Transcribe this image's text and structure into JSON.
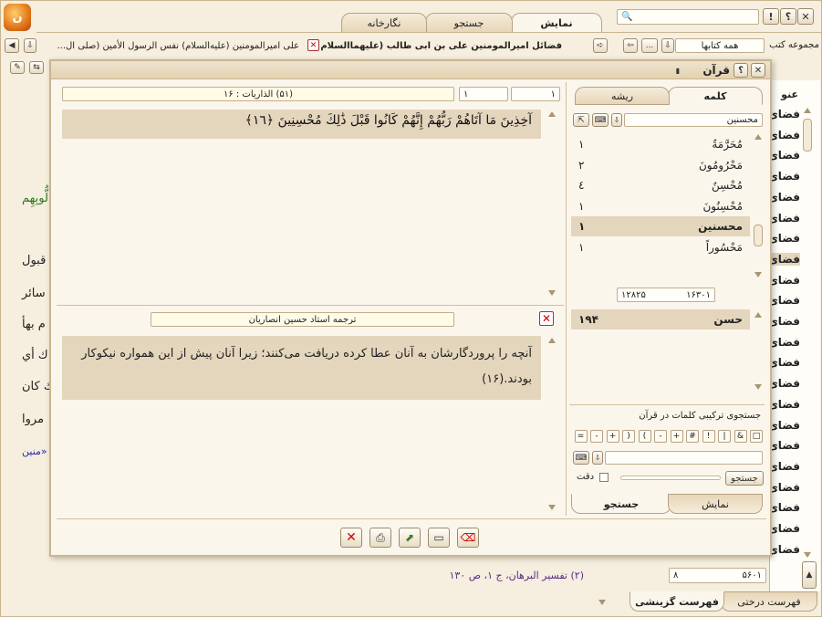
{
  "top_tabs": [
    {
      "label": "نمایش",
      "active": true
    },
    {
      "label": "جستجو",
      "active": false
    },
    {
      "label": "نگارخانه",
      "active": false
    }
  ],
  "top_right_buttons": {
    "close": "✕",
    "help": "؟",
    "alert": "!"
  },
  "search": {
    "placeholder": ""
  },
  "library": {
    "label": "مجموعه کتب",
    "selected": "همه کتابها"
  },
  "doc_tabs": [
    {
      "label": "فضائل امیرالمومنین علی بن ابی طالب (علیهماالسلام) فی..."
    },
    {
      "label": "علی امیرالمومنین (علیه‌السلام) نفس الرسول الأمین (صلی ال..."
    }
  ],
  "sidebar": {
    "header": "عنو",
    "item_label": "فضائ",
    "count": 22
  },
  "sidebar_footer": {
    "nav_left": "۵۶۰۱",
    "nav_right": "۸",
    "tabs": [
      {
        "label": "فهرست درختی"
      },
      {
        "label": "فهرست گزینشی"
      }
    ]
  },
  "background_text": {
    "words": [
      "لُّوبِهِم",
      "قبول",
      "سائر",
      "م بهأ",
      "ك أي",
      "ك كان",
      "مروا",
      "منين»"
    ],
    "footnote": "(۲) تفسیر البرهان، ج ۱، ص ۱۳۰"
  },
  "quran": {
    "title": "قرآن",
    "verse_nav": {
      "sura": "(۵۱) الذاريات : ۱۶",
      "field_a": "۱",
      "field_b": "۱"
    },
    "verse_text": "آخِذِينَ مَا آتَاهُمْ رَبُّهُمْ إِنَّهُمْ كَانُوا قَبْلَ ذَٰلِكَ مُحْسِنِينَ ﴿١٦﴾",
    "translation_title": "ترجمه استاد حسین انصاریان",
    "translation": "آنچه را پروردگارشان به آنان عطا کرده دریافت می‌کنند؛ زیرا آنان پیش از این همواره نیکوکار بودند.(۱۶)",
    "panel_tabs": [
      {
        "label": "کلمه",
        "active": true
      },
      {
        "label": "ریشه",
        "active": false
      }
    ],
    "word_search": "محسنین",
    "words": [
      {
        "word": "مُحَرَّمَةٌ",
        "count": "۱"
      },
      {
        "word": "مَحْرُومُونَ",
        "count": "۲"
      },
      {
        "word": "مُحْسِنٌ",
        "count": "٤"
      },
      {
        "word": "مُحْسِنُونَ",
        "count": "۱"
      },
      {
        "word": "محسنين",
        "count": "۱",
        "selected": true
      },
      {
        "word": "مَحْسُوراً",
        "count": "۱"
      }
    ],
    "totals": {
      "a": "۱۶۳۰۱",
      "b": "۱۲۸۲۵"
    },
    "root": {
      "word": "حسن",
      "count": "۱۹۴"
    },
    "combo_title": "جستجوی ترکیبی کلمات در قرآن",
    "symbols": [
      "□",
      "&",
      "|",
      "!",
      "#",
      "+",
      "-",
      "(",
      ")",
      "+",
      "-",
      "="
    ],
    "search_button": "جستجو",
    "precision_label": "دقت",
    "bottom_tabs": [
      {
        "label": "جستجو",
        "active": true
      },
      {
        "label": "نمایش",
        "active": false
      }
    ]
  },
  "colors": {
    "accent": "#cc2222",
    "frame": "#c9b58f",
    "bg": "#f4ead6",
    "verse_bg": "#e4d5bd"
  }
}
